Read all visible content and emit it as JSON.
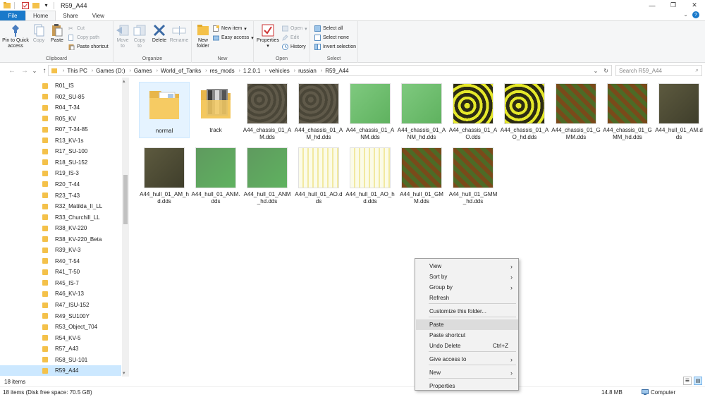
{
  "window": {
    "title": "R59_A44",
    "minimize_glyph": "—",
    "maximize_glyph": "❐",
    "close_glyph": "✕"
  },
  "quick_access": {
    "dropdown_glyph": "▾"
  },
  "tabs": [
    {
      "label": "File"
    },
    {
      "label": "Home"
    },
    {
      "label": "Share"
    },
    {
      "label": "View"
    }
  ],
  "ribbon": {
    "collapse_glyph": "⌄",
    "help_glyph": "?",
    "clipboard": {
      "label": "Clipboard",
      "pin": "Pin to Quick access",
      "copy": "Copy",
      "paste": "Paste",
      "cut": "Cut",
      "copy_path": "Copy path",
      "paste_shortcut": "Paste shortcut"
    },
    "organize": {
      "label": "Organize",
      "move_to": "Move to",
      "copy_to": "Copy to",
      "delete": "Delete",
      "rename": "Rename"
    },
    "new": {
      "label": "New",
      "new_folder": "New folder",
      "new_item": "New item",
      "easy_access": "Easy access"
    },
    "open": {
      "label": "Open",
      "properties": "Properties",
      "open": "Open",
      "edit": "Edit",
      "history": "History"
    },
    "select": {
      "label": "Select",
      "select_all": "Select all",
      "select_none": "Select none",
      "invert": "Invert selection"
    }
  },
  "address": {
    "back_glyph": "←",
    "forward_glyph": "→",
    "history_glyph": "⌄",
    "up_glyph": "↑",
    "separator": "›",
    "crumbs": [
      "This PC",
      "Games (D:)",
      "Games",
      "World_of_Tanks",
      "res_mods",
      "1.2.0.1",
      "vehicles",
      "russian",
      "R59_A44"
    ],
    "dropdown_glyph": "⌄",
    "refresh_glyph": "↻",
    "search_placeholder": "Search R59_A44",
    "search_glyph": "⌕"
  },
  "sidebar": {
    "items": [
      "R01_IS",
      "R02_SU-85",
      "R04_T-34",
      "R05_KV",
      "R07_T-34-85",
      "R13_KV-1s",
      "R17_SU-100",
      "R18_SU-152",
      "R19_IS-3",
      "R20_T-44",
      "R23_T-43",
      "R32_Matilda_II_LL",
      "R33_Churchill_LL",
      "R38_KV-220",
      "R38_KV-220_Beta",
      "R39_KV-3",
      "R40_T-54",
      "R41_T-50",
      "R45_IS-7",
      "R46_KV-13",
      "R47_ISU-152",
      "R49_SU100Y",
      "R53_Object_704",
      "R54_KV-5",
      "R57_A43",
      "R58_SU-101",
      "R59_A44"
    ],
    "selected": "R59_A44",
    "scroll_up_glyph": "▴",
    "scroll_down_glyph": "▾",
    "footer": "18 items"
  },
  "files": [
    {
      "name": "normal",
      "kind": "folder"
    },
    {
      "name": "track",
      "kind": "track"
    },
    {
      "name": "A44_chassis_01_AM.dds",
      "kind": "gray"
    },
    {
      "name": "A44_chassis_01_AM_hd.dds",
      "kind": "gray"
    },
    {
      "name": "A44_chassis_01_ANM.dds",
      "kind": "green"
    },
    {
      "name": "A44_chassis_01_ANM_hd.dds",
      "kind": "green"
    },
    {
      "name": "A44_chassis_01_AO.dds",
      "kind": "yellow"
    },
    {
      "name": "A44_chassis_01_AO_hd.dds",
      "kind": "yellow"
    },
    {
      "name": "A44_chassis_01_GMM.dds",
      "kind": "brown"
    },
    {
      "name": "A44_chassis_01_GMM_hd.dds",
      "kind": "brown"
    },
    {
      "name": "A44_hull_01_AM.dds",
      "kind": "olive"
    },
    {
      "name": "A44_hull_01_AM_hd.dds",
      "kind": "olive"
    },
    {
      "name": "A44_hull_01_ANM.dds",
      "kind": "hullgreen"
    },
    {
      "name": "A44_hull_01_ANM_hd.dds",
      "kind": "hullgreen"
    },
    {
      "name": "A44_hull_01_AO.dds",
      "kind": "ao"
    },
    {
      "name": "A44_hull_01_AO_hd.dds",
      "kind": "ao"
    },
    {
      "name": "A44_hull_01_GMM.dds",
      "kind": "brown"
    },
    {
      "name": "A44_hull_01_GMM_hd.dds",
      "kind": "brown"
    }
  ],
  "context_menu": {
    "items": [
      {
        "label": "View",
        "submenu": true
      },
      {
        "label": "Sort by",
        "submenu": true
      },
      {
        "label": "Group by",
        "submenu": true
      },
      {
        "label": "Refresh"
      },
      {
        "label": "Customize this folder..."
      },
      {
        "label": "Paste",
        "highlight": true
      },
      {
        "label": "Paste shortcut"
      },
      {
        "label": "Undo Delete",
        "shortcut": "Ctrl+Z"
      },
      {
        "label": "Give access to",
        "submenu": true
      },
      {
        "label": "New",
        "submenu": true
      },
      {
        "label": "Properties"
      }
    ],
    "submenu_glyph": "›"
  },
  "statusbar": {
    "left": "18 items (Disk free space: 70.5 GB)",
    "size": "14.8 MB",
    "location": "Computer",
    "details_glyph": "☰",
    "tiles_glyph": "▤"
  }
}
